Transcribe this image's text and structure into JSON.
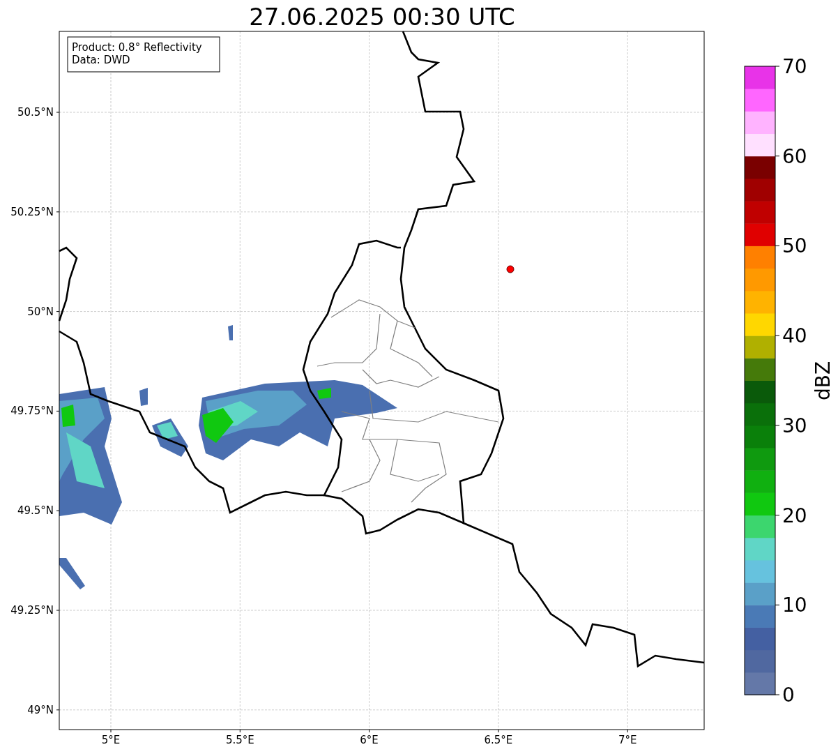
{
  "title": "27.06.2025 00:30 UTC",
  "info_box": {
    "lines": [
      "Product: 0.8° Reflectivity",
      "Data: DWD"
    ]
  },
  "map": {
    "y_ticks": [
      "50.5°N",
      "50.25°N",
      "50°N",
      "49.75°N",
      "49.5°N",
      "49.25°N",
      "49°N"
    ],
    "x_ticks": [
      "5°E",
      "5.5°E",
      "6°E",
      "6.5°E",
      "7°E"
    ]
  },
  "colorbar": {
    "label": "dBZ",
    "tick_labels": [
      "70",
      "60",
      "50",
      "40",
      "30",
      "20",
      "10",
      "0"
    ],
    "segments": [
      {
        "color": "#6478a8"
      },
      {
        "color": "#5068a0"
      },
      {
        "color": "#4460a2"
      },
      {
        "color": "#4a7ab6"
      },
      {
        "color": "#5aa0c8"
      },
      {
        "color": "#66c2de"
      },
      {
        "color": "#60d6c6"
      },
      {
        "color": "#3cd66e"
      },
      {
        "color": "#10c810"
      },
      {
        "color": "#10b010"
      },
      {
        "color": "#0f9a0f"
      },
      {
        "color": "#0a800a"
      },
      {
        "color": "#0a700a"
      },
      {
        "color": "#0a5a0a"
      },
      {
        "color": "#457a0a"
      },
      {
        "color": "#b0b000"
      },
      {
        "color": "#ffd700"
      },
      {
        "color": "#ffb300"
      },
      {
        "color": "#ff9900"
      },
      {
        "color": "#ff8000"
      },
      {
        "color": "#e00000"
      },
      {
        "color": "#c00000"
      },
      {
        "color": "#a00000"
      },
      {
        "color": "#7a0000"
      },
      {
        "color": "#ffe0ff"
      },
      {
        "color": "#ffb3ff"
      },
      {
        "color": "#ff66ff"
      },
      {
        "color": "#e833e8"
      }
    ]
  }
}
